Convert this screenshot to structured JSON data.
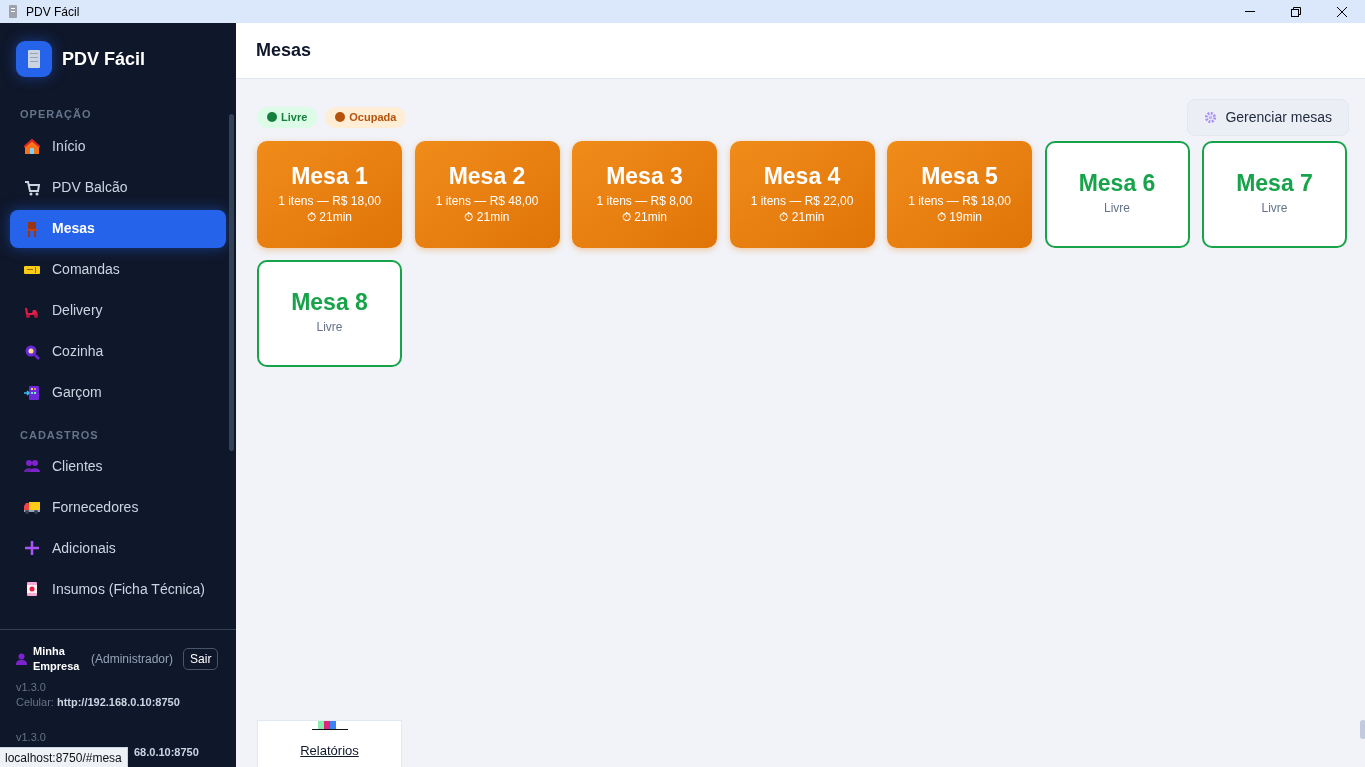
{
  "window": {
    "title": "PDV Fácil"
  },
  "sidebar": {
    "brand": "PDV Fácil",
    "sections": [
      {
        "title": "OPERAÇÃO",
        "items": [
          {
            "label": "Início",
            "selected": false
          },
          {
            "label": "PDV Balcão",
            "selected": false
          },
          {
            "label": "Mesas",
            "selected": true
          },
          {
            "label": "Comandas",
            "selected": false
          },
          {
            "label": "Delivery",
            "selected": false
          },
          {
            "label": "Cozinha",
            "selected": false
          },
          {
            "label": "Garçom",
            "selected": false
          }
        ]
      },
      {
        "title": "CADASTROS",
        "items": [
          {
            "label": "Clientes",
            "selected": false
          },
          {
            "label": "Fornecedores",
            "selected": false
          },
          {
            "label": "Adicionais",
            "selected": false
          },
          {
            "label": "Insumos (Ficha Técnica)",
            "selected": false
          }
        ]
      }
    ],
    "user": {
      "name": "Minha Empresa",
      "role": "(Administrador)",
      "logout": "Sair"
    },
    "footer": [
      {
        "version": "v1.3.0",
        "label": "Celular:",
        "url": "http://192.168.0.10:8750"
      },
      {
        "version": "v1.3.0",
        "url": "68.0.10:8750"
      }
    ]
  },
  "header": {
    "title": "Mesas"
  },
  "legend": [
    {
      "label": "Livre",
      "color": "#15803d",
      "kind": "free"
    },
    {
      "label": "Ocupada",
      "color": "#b45309",
      "kind": "busy"
    }
  ],
  "manage_button": "Gerenciar mesas",
  "tables": [
    {
      "name": "Mesa 1",
      "kind": "busy",
      "summary": "1 itens — R$ 18,00",
      "time": "⏱ 21min"
    },
    {
      "name": "Mesa 2",
      "kind": "busy",
      "summary": "1 itens — R$ 48,00",
      "time": "⏱ 21min"
    },
    {
      "name": "Mesa 3",
      "kind": "busy",
      "summary": "1 itens — R$ 8,00",
      "time": "⏱ 21min"
    },
    {
      "name": "Mesa 4",
      "kind": "busy",
      "summary": "1 itens — R$ 22,00",
      "time": "⏱ 21min"
    },
    {
      "name": "Mesa 5",
      "kind": "busy",
      "summary": "1 itens — R$ 18,00",
      "time": "⏱ 19min"
    },
    {
      "name": "Mesa 6",
      "kind": "free",
      "summary": "Livre"
    },
    {
      "name": "Mesa 7",
      "kind": "free",
      "summary": "Livre"
    },
    {
      "name": "Mesa 8",
      "kind": "free",
      "summary": "Livre"
    }
  ],
  "floating_link": "Relatórios",
  "status_url": "localhost:8750/#mesa"
}
